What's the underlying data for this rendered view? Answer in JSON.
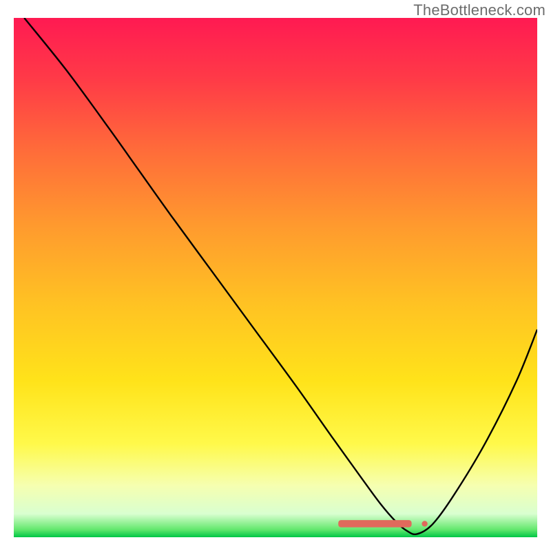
{
  "watermark": "TheBottleneck.com",
  "chart_data": {
    "type": "line",
    "title": "",
    "xlabel": "",
    "ylabel": "",
    "xlim": [
      0,
      100
    ],
    "ylim": [
      0,
      100
    ],
    "grid": false,
    "legend": false,
    "gradient_stops": [
      {
        "offset": 0.0,
        "color": "#ff1a52"
      },
      {
        "offset": 0.12,
        "color": "#ff3b47"
      },
      {
        "offset": 0.25,
        "color": "#ff6a3a"
      },
      {
        "offset": 0.4,
        "color": "#ff9a2e"
      },
      {
        "offset": 0.55,
        "color": "#ffc223"
      },
      {
        "offset": 0.7,
        "color": "#ffe31a"
      },
      {
        "offset": 0.82,
        "color": "#fff94a"
      },
      {
        "offset": 0.9,
        "color": "#f6ffb0"
      },
      {
        "offset": 0.955,
        "color": "#d9ffd0"
      },
      {
        "offset": 0.985,
        "color": "#64e86e"
      },
      {
        "offset": 1.0,
        "color": "#00c646"
      }
    ],
    "series": [
      {
        "name": "curve",
        "color": "#000000",
        "x": [
          2,
          10,
          18,
          24,
          30,
          38,
          46,
          54,
          61,
          66,
          70,
          73,
          75,
          77,
          80,
          84,
          90,
          96,
          100
        ],
        "y": [
          100,
          90,
          79,
          70.5,
          62,
          51,
          40,
          29,
          19,
          12,
          6.5,
          3,
          1.3,
          0.6,
          2.5,
          8,
          18,
          30,
          40
        ]
      }
    ],
    "annotations": [
      {
        "name": "marker-band",
        "type": "bar",
        "color": "#e06a5c",
        "x_start": 62,
        "x_end": 76,
        "y": 2.6,
        "height": 1.4
      },
      {
        "name": "marker-dot",
        "type": "dot",
        "color": "#e06a5c",
        "x": 78.5,
        "y": 2.6,
        "r": 0.55
      }
    ]
  }
}
